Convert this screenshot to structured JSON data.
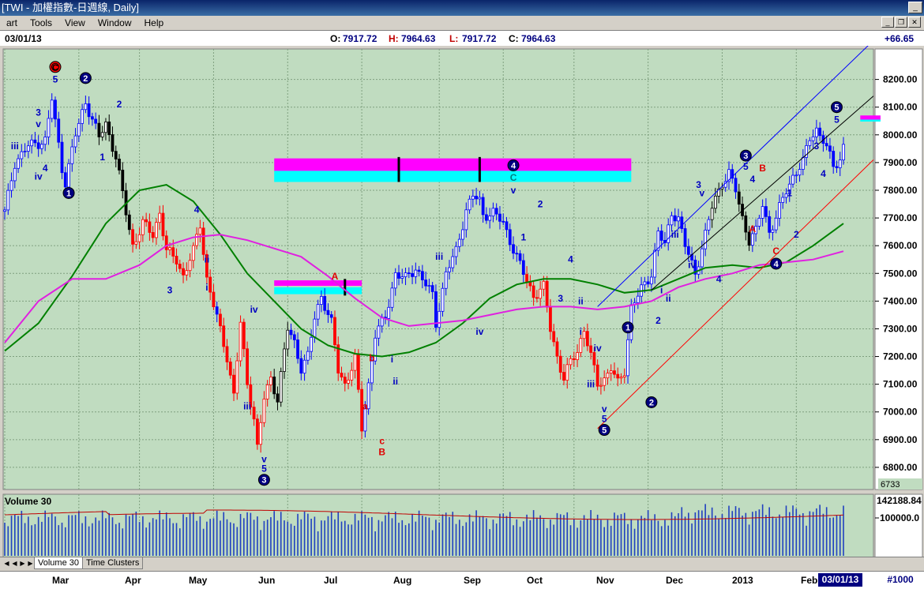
{
  "window": {
    "title": "[TWI - 加權指數-日週線, Daily]"
  },
  "menu": [
    {
      "label": "art",
      "key": ""
    },
    {
      "label": "Tools",
      "key": "T"
    },
    {
      "label": "View",
      "key": "V"
    },
    {
      "label": "Window",
      "key": "W"
    },
    {
      "label": "Help",
      "key": "H"
    }
  ],
  "quote": {
    "date": "03/01/13",
    "open_label": "O:",
    "open": "7917.72",
    "high_label": "H:",
    "high": "7964.63",
    "low_label": "L:",
    "low": "7917.72",
    "close_label": "C:",
    "close": "7964.63",
    "change": "+66.65"
  },
  "tabs": [
    {
      "label": "Volume 30",
      "active": true
    },
    {
      "label": "Time Clusters",
      "active": false
    }
  ],
  "date_axis": {
    "months": [
      "Mar",
      "Apr",
      "May",
      "Jun",
      "Jul",
      "Aug",
      "Sep",
      "Oct",
      "Nov",
      "Dec",
      "2013",
      "Feb"
    ],
    "current_date": "03/01/13",
    "badge": "#1000"
  },
  "colors": {
    "background": "#c0dcc0",
    "grid": "#7fa07f",
    "bars_blue": "#0000ff",
    "bars_red": "#ff0000",
    "bars_black": "#000000",
    "ma_green": "#008000",
    "ma_magenta": "#e020e0",
    "zone_magenta": "#ff00ff",
    "zone_cyan": "#00ffff",
    "wave_label_blue": "#0000c0"
  },
  "chart_data": {
    "type": "candlestick",
    "y_ticks": [
      8200,
      8100,
      8000,
      7900,
      7800,
      7700,
      7600,
      7500,
      7400,
      7300,
      7200,
      7100,
      7000,
      6900,
      6800
    ],
    "y_tick_labels": [
      "8200.00",
      "8100.00",
      "8000.00",
      "7900.00",
      "7800.00",
      "7700.00",
      "7600.00",
      "7500.00",
      "7400.00",
      "7300.00",
      "7200.00",
      "7100.00",
      "7000.00",
      "6900.00",
      "6800.00"
    ],
    "ylim": [
      6720,
      8310
    ],
    "last_price_tag": "6733",
    "x_days": 260,
    "month_starts": [
      [
        0,
        "Mar"
      ],
      [
        22,
        "Apr"
      ],
      [
        40,
        "May"
      ],
      [
        62,
        "Jun"
      ],
      [
        84,
        "Jul"
      ],
      [
        106,
        "Aug"
      ],
      [
        129,
        "Sep"
      ],
      [
        148,
        "Oct"
      ],
      [
        169,
        "Nov"
      ],
      [
        191,
        "Dec"
      ],
      [
        213,
        "2013"
      ],
      [
        235,
        "Feb"
      ]
    ],
    "close_path": [
      [
        0,
        7720
      ],
      [
        3,
        7900
      ],
      [
        7,
        7960
      ],
      [
        12,
        7980
      ],
      [
        14,
        8130
      ],
      [
        17,
        7880
      ],
      [
        18,
        7830
      ],
      [
        21,
        8000
      ],
      [
        24,
        8120
      ],
      [
        28,
        7990
      ],
      [
        30,
        8040
      ],
      [
        33,
        7920
      ],
      [
        36,
        7720
      ],
      [
        38,
        7600
      ],
      [
        41,
        7680
      ],
      [
        44,
        7640
      ],
      [
        46,
        7720
      ],
      [
        48,
        7580
      ],
      [
        51,
        7550
      ],
      [
        53,
        7490
      ],
      [
        56,
        7580
      ],
      [
        58,
        7680
      ],
      [
        60,
        7480
      ],
      [
        63,
        7340
      ],
      [
        66,
        7200
      ],
      [
        68,
        7060
      ],
      [
        70,
        7320
      ],
      [
        72,
        7100
      ],
      [
        74,
        6980
      ],
      [
        75,
        6870
      ],
      [
        77,
        7050
      ],
      [
        79,
        7120
      ],
      [
        81,
        7050
      ],
      [
        84,
        7300
      ],
      [
        86,
        7250
      ],
      [
        88,
        7160
      ],
      [
        90,
        7200
      ],
      [
        92,
        7340
      ],
      [
        94,
        7420
      ],
      [
        97,
        7320
      ],
      [
        99,
        7150
      ],
      [
        101,
        7100
      ],
      [
        104,
        7190
      ],
      [
        106,
        6940
      ],
      [
        108,
        7100
      ],
      [
        110,
        7280
      ],
      [
        113,
        7340
      ],
      [
        116,
        7500
      ],
      [
        119,
        7480
      ],
      [
        122,
        7520
      ],
      [
        125,
        7460
      ],
      [
        127,
        7420
      ],
      [
        128,
        7320
      ],
      [
        131,
        7500
      ],
      [
        134,
        7580
      ],
      [
        137,
        7730
      ],
      [
        139,
        7780
      ],
      [
        141,
        7760
      ],
      [
        142,
        7710
      ],
      [
        145,
        7720
      ],
      [
        148,
        7680
      ],
      [
        151,
        7590
      ],
      [
        154,
        7500
      ],
      [
        157,
        7420
      ],
      [
        160,
        7450
      ],
      [
        162,
        7300
      ],
      [
        164,
        7200
      ],
      [
        166,
        7120
      ],
      [
        168,
        7180
      ],
      [
        170,
        7220
      ],
      [
        172,
        7300
      ],
      [
        174,
        7200
      ],
      [
        176,
        7100
      ],
      [
        178,
        7120
      ],
      [
        180,
        7160
      ],
      [
        182,
        7100
      ],
      [
        184,
        7150
      ],
      [
        186,
        7380
      ],
      [
        188,
        7420
      ],
      [
        190,
        7460
      ],
      [
        192,
        7500
      ],
      [
        194,
        7650
      ],
      [
        196,
        7600
      ],
      [
        198,
        7720
      ],
      [
        200,
        7700
      ],
      [
        202,
        7600
      ],
      [
        205,
        7500
      ],
      [
        208,
        7640
      ],
      [
        210,
        7740
      ],
      [
        213,
        7830
      ],
      [
        215,
        7860
      ],
      [
        217,
        7800
      ],
      [
        219,
        7700
      ],
      [
        221,
        7620
      ],
      [
        223,
        7650
      ],
      [
        225,
        7750
      ],
      [
        227,
        7650
      ],
      [
        229,
        7700
      ],
      [
        232,
        7800
      ],
      [
        234,
        7850
      ],
      [
        237,
        7900
      ],
      [
        239,
        7990
      ],
      [
        241,
        8020
      ],
      [
        243,
        7980
      ],
      [
        246,
        7890
      ],
      [
        248,
        7910
      ],
      [
        249,
        7960
      ]
    ],
    "red_ranges": [
      [
        37,
        62
      ],
      [
        64,
        80
      ],
      [
        98,
        106
      ],
      [
        155,
        184
      ]
    ],
    "black_ranges": [
      [
        28,
        37
      ],
      [
        80,
        84
      ],
      [
        210,
        213
      ],
      [
        218,
        221
      ]
    ],
    "ma_green": [
      [
        0,
        7220
      ],
      [
        10,
        7320
      ],
      [
        20,
        7490
      ],
      [
        30,
        7680
      ],
      [
        40,
        7800
      ],
      [
        48,
        7820
      ],
      [
        56,
        7760
      ],
      [
        64,
        7640
      ],
      [
        72,
        7500
      ],
      [
        80,
        7400
      ],
      [
        88,
        7300
      ],
      [
        96,
        7240
      ],
      [
        104,
        7210
      ],
      [
        112,
        7200
      ],
      [
        120,
        7215
      ],
      [
        128,
        7250
      ],
      [
        136,
        7320
      ],
      [
        144,
        7410
      ],
      [
        152,
        7460
      ],
      [
        160,
        7480
      ],
      [
        168,
        7480
      ],
      [
        176,
        7460
      ],
      [
        184,
        7430
      ],
      [
        192,
        7440
      ],
      [
        200,
        7480
      ],
      [
        208,
        7520
      ],
      [
        216,
        7530
      ],
      [
        224,
        7520
      ],
      [
        232,
        7540
      ],
      [
        240,
        7600
      ],
      [
        249,
        7680
      ]
    ],
    "ma_magenta": [
      [
        0,
        7250
      ],
      [
        10,
        7400
      ],
      [
        20,
        7480
      ],
      [
        30,
        7480
      ],
      [
        40,
        7530
      ],
      [
        48,
        7600
      ],
      [
        56,
        7630
      ],
      [
        64,
        7640
      ],
      [
        72,
        7620
      ],
      [
        80,
        7590
      ],
      [
        88,
        7560
      ],
      [
        96,
        7490
      ],
      [
        104,
        7410
      ],
      [
        112,
        7340
      ],
      [
        120,
        7310
      ],
      [
        128,
        7320
      ],
      [
        136,
        7330
      ],
      [
        144,
        7350
      ],
      [
        152,
        7370
      ],
      [
        160,
        7380
      ],
      [
        168,
        7380
      ],
      [
        176,
        7370
      ],
      [
        184,
        7380
      ],
      [
        192,
        7400
      ],
      [
        200,
        7450
      ],
      [
        208,
        7480
      ],
      [
        216,
        7500
      ],
      [
        224,
        7530
      ],
      [
        232,
        7540
      ],
      [
        240,
        7550
      ],
      [
        249,
        7580
      ]
    ],
    "trendlines": [
      {
        "color": "#0000ff",
        "from": [
          176,
          7380
        ],
        "to": [
          257,
          8330
        ]
      },
      {
        "color": "#000000",
        "from": [
          192,
          7440
        ],
        "to": [
          259,
          8140
        ]
      },
      {
        "color": "#ff0000",
        "from": [
          176,
          6940
        ],
        "to": [
          259,
          7910
        ]
      }
    ],
    "zones": [
      {
        "x0": 80,
        "x1": 186,
        "y_magenta": [
          7870,
          7915
        ],
        "y_cyan": [
          7830,
          7870
        ]
      },
      {
        "x0": 80,
        "x1": 106,
        "y_magenta": [
          7455,
          7475
        ],
        "y_cyan": [
          7425,
          7450
        ]
      },
      {
        "x0": 254,
        "x1": 260,
        "y_magenta": [
          8055,
          8070
        ],
        "y_cyan": [
          8048,
          8055
        ]
      }
    ],
    "zone_markers": [
      [
        117,
        7830,
        7920
      ],
      [
        141,
        7830,
        7920
      ],
      [
        101,
        7420,
        7480
      ]
    ],
    "wave_labels": [
      {
        "t": "C",
        "x": 15,
        "y": 8245,
        "c": "circle-red"
      },
      {
        "t": "5",
        "x": 15,
        "y": 8200,
        "c": "blue"
      },
      {
        "t": "2",
        "x": 24,
        "y": 8205,
        "c": "circle-blue"
      },
      {
        "t": "2",
        "x": 34,
        "y": 8110,
        "c": "blue"
      },
      {
        "t": "3",
        "x": 10,
        "y": 8080,
        "c": "blue"
      },
      {
        "t": "v",
        "x": 10,
        "y": 8040,
        "c": "blue"
      },
      {
        "t": "iii",
        "x": 3,
        "y": 7960,
        "c": "blue"
      },
      {
        "t": "iv",
        "x": 10,
        "y": 7850,
        "c": "blue"
      },
      {
        "t": "4",
        "x": 12,
        "y": 7880,
        "c": "blue"
      },
      {
        "t": "1",
        "x": 29,
        "y": 7920,
        "c": "blue"
      },
      {
        "t": "1",
        "x": 19,
        "y": 7790,
        "c": "circle-blue"
      },
      {
        "t": "4",
        "x": 57,
        "y": 7730,
        "c": "blue"
      },
      {
        "t": "ii",
        "x": 60,
        "y": 7550,
        "c": "blue"
      },
      {
        "t": "3",
        "x": 49,
        "y": 7440,
        "c": "blue"
      },
      {
        "t": "i",
        "x": 60,
        "y": 7450,
        "c": "blue"
      },
      {
        "t": "iv",
        "x": 74,
        "y": 7370,
        "c": "blue"
      },
      {
        "t": "iii",
        "x": 72,
        "y": 7020,
        "c": "blue"
      },
      {
        "t": "v",
        "x": 77,
        "y": 6830,
        "c": "blue"
      },
      {
        "t": "5",
        "x": 77,
        "y": 6795,
        "c": "blue"
      },
      {
        "t": "3",
        "x": 77,
        "y": 6755,
        "c": "circle-blue"
      },
      {
        "t": "A",
        "x": 98,
        "y": 7490,
        "c": "red"
      },
      {
        "t": "b",
        "x": 109,
        "y": 7195,
        "c": "red"
      },
      {
        "t": "a",
        "x": 107,
        "y": 7020,
        "c": "red"
      },
      {
        "t": "c",
        "x": 112,
        "y": 6895,
        "c": "red"
      },
      {
        "t": "B",
        "x": 112,
        "y": 6855,
        "c": "red"
      },
      {
        "t": "i",
        "x": 115,
        "y": 7190,
        "c": "blue"
      },
      {
        "t": "ii",
        "x": 116,
        "y": 7110,
        "c": "blue"
      },
      {
        "t": "iii",
        "x": 129,
        "y": 7560,
        "c": "blue"
      },
      {
        "t": "iv",
        "x": 141,
        "y": 7290,
        "c": "blue"
      },
      {
        "t": "4",
        "x": 151,
        "y": 7890,
        "c": "circle-blue"
      },
      {
        "t": "C",
        "x": 151,
        "y": 7845,
        "c": "teal"
      },
      {
        "t": "v",
        "x": 151,
        "y": 7800,
        "c": "blue"
      },
      {
        "t": "2",
        "x": 159,
        "y": 7750,
        "c": "blue"
      },
      {
        "t": "1",
        "x": 154,
        "y": 7630,
        "c": "blue"
      },
      {
        "t": "4",
        "x": 168,
        "y": 7550,
        "c": "blue"
      },
      {
        "t": "3",
        "x": 165,
        "y": 7410,
        "c": "blue"
      },
      {
        "t": "ii",
        "x": 171,
        "y": 7400,
        "c": "blue"
      },
      {
        "t": "i",
        "x": 171,
        "y": 7290,
        "c": "blue"
      },
      {
        "t": "iv",
        "x": 176,
        "y": 7230,
        "c": "blue"
      },
      {
        "t": "iii",
        "x": 174,
        "y": 7100,
        "c": "blue"
      },
      {
        "t": "v",
        "x": 178,
        "y": 7010,
        "c": "blue"
      },
      {
        "t": "5",
        "x": 178,
        "y": 6975,
        "c": "blue"
      },
      {
        "t": "5",
        "x": 178,
        "y": 6935,
        "c": "circle-blue"
      },
      {
        "t": "1",
        "x": 185,
        "y": 7305,
        "c": "circle-blue"
      },
      {
        "t": "2",
        "x": 194,
        "y": 7330,
        "c": "blue"
      },
      {
        "t": "2",
        "x": 192,
        "y": 7035,
        "c": "circle-blue"
      },
      {
        "t": "i",
        "x": 195,
        "y": 7440,
        "c": "blue"
      },
      {
        "t": "ii",
        "x": 197,
        "y": 7410,
        "c": "blue"
      },
      {
        "t": "iii",
        "x": 199,
        "y": 7640,
        "c": "blue"
      },
      {
        "t": "iv",
        "x": 204,
        "y": 7530,
        "c": "blue"
      },
      {
        "t": "3",
        "x": 206,
        "y": 7820,
        "c": "blue"
      },
      {
        "t": "v",
        "x": 207,
        "y": 7790,
        "c": "blue"
      },
      {
        "t": "4",
        "x": 212,
        "y": 7480,
        "c": "blue"
      },
      {
        "t": "3",
        "x": 220,
        "y": 7925,
        "c": "circle-blue"
      },
      {
        "t": "5",
        "x": 220,
        "y": 7885,
        "c": "blue"
      },
      {
        "t": "4",
        "x": 222,
        "y": 7840,
        "c": "blue"
      },
      {
        "t": "B",
        "x": 225,
        "y": 7880,
        "c": "red"
      },
      {
        "t": "A",
        "x": 222,
        "y": 7660,
        "c": "red"
      },
      {
        "t": "C",
        "x": 229,
        "y": 7580,
        "c": "red"
      },
      {
        "t": "4",
        "x": 229,
        "y": 7535,
        "c": "circle-blue"
      },
      {
        "t": "1",
        "x": 233,
        "y": 7790,
        "c": "blue"
      },
      {
        "t": "2",
        "x": 235,
        "y": 7640,
        "c": "blue"
      },
      {
        "t": "3",
        "x": 241,
        "y": 7960,
        "c": "blue"
      },
      {
        "t": "4",
        "x": 243,
        "y": 7860,
        "c": "blue"
      },
      {
        "t": "5",
        "x": 247,
        "y": 8100,
        "c": "circle-blue"
      },
      {
        "t": "5",
        "x": 247,
        "y": 8055,
        "c": "blue"
      }
    ],
    "volume": {
      "title": "Volume 30",
      "value_label": "142188.84",
      "tick_label": "100000.0"
    }
  }
}
